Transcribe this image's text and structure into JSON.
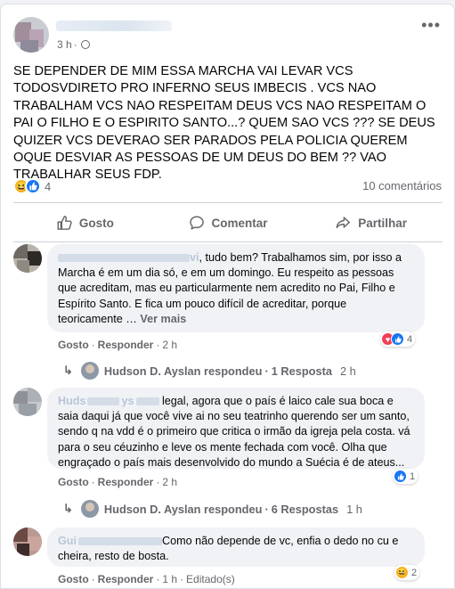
{
  "post": {
    "time": "3 h",
    "text": "SE DEPENDER DE MIM ESSA MARCHA VAI LEVAR VCS TODOSVDIRETO PRO INFERNO SEUS IMBECIS . VCS NAO TRABALHAM VCS NAO RESPEITAM DEUS VCS NAO RESPEITAM O PAI O FILHO E O ESPIRITO SANTO...? QUEM SAO VCS ??? SE DEUS QUIZER VCS DEVERAO SER PARADOS PELA POLICIA QUEREM OQUE DESVIAR AS PESSOAS DE UM DEUS DO BEM ?? VAO TRABALHAR SEUS FDP.",
    "reaction_count": "4",
    "comment_count": "10 comentários",
    "reaction_icons": [
      "haha",
      "like"
    ]
  },
  "actions": {
    "like": "Gosto",
    "comment": "Comentar",
    "share": "Partilhar"
  },
  "comments": [
    {
      "name_suffix": "vi",
      "text_lead": ", tudo bem? Trabalhamos sim, por isso a Marcha é em um dia só, e em um domingo. Eu respeito as pessoas que acreditam, mas eu particularmente nem acredito no Pai, Filho e Espírito Santo. E fica um pouco difícil de acreditar, porque teoricamente … ",
      "see_more": "Ver mais",
      "like": "Gosto",
      "reply": "Responder",
      "time": "2 h",
      "reaction_count": "4",
      "reaction_icons": [
        "love",
        "like"
      ],
      "replies_line": {
        "name": "Hudson D. Ayslan respondeu",
        "count": "1 Resposta",
        "time": "2 h"
      }
    },
    {
      "name_prefix": "Huds",
      "name_mid": "ys",
      "text": " legal, agora que o país é laico cale sua boca e saia daqui já que você vive ai no seu teatrinho querendo ser um santo, sendo q na vdd é o primeiro que critica o irmão da igreja pela costa. vá para o seu céuzinho e leve os mente fechada com você. Olha que engraçado o país mais desenvolvido do mundo a Suécia é de ateus...",
      "like": "Gosto",
      "reply": "Responder",
      "time": "2 h",
      "reaction_count": "1",
      "reaction_icons": [
        "like"
      ],
      "replies_line": {
        "name": "Hudson D. Ayslan respondeu",
        "count": "6 Respostas",
        "time": "1 h"
      }
    },
    {
      "name_prefix": "Gui",
      "text": "Como não depende de vc, enfia o dedo no cu e cheira, resto de bosta.",
      "like": "Gosto",
      "reply": "Responder",
      "time": "1 h",
      "edited": "Editado(s)",
      "reaction_count": "2",
      "reaction_icons": [
        "haha"
      ]
    }
  ],
  "colors": {
    "background": "#f0f2f5",
    "secondary_text": "#65676b",
    "like_blue": "#1877f2",
    "love_red": "#f33e58",
    "haha_yellow": "#f7b125"
  }
}
